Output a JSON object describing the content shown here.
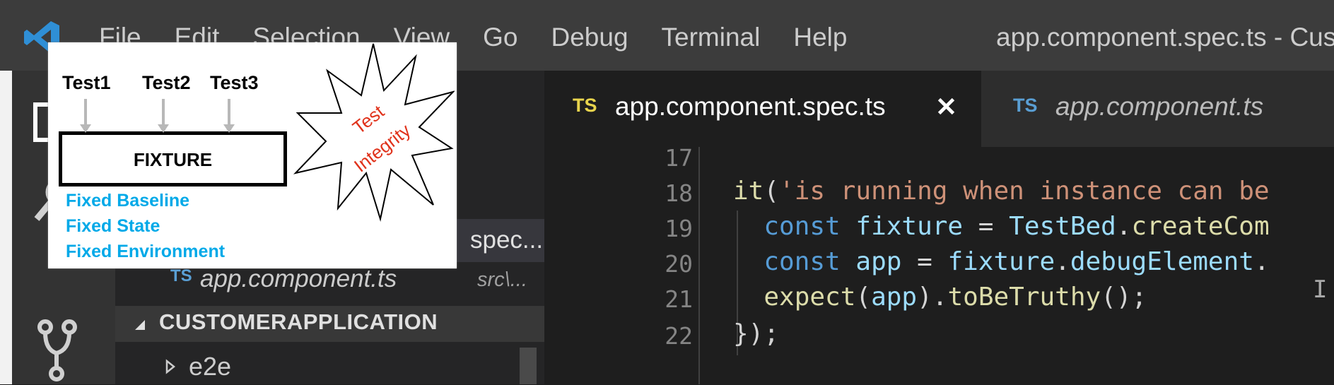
{
  "titlebar": {
    "menu": [
      "File",
      "Edit",
      "Selection",
      "View",
      "Go",
      "Debug",
      "Terminal",
      "Help"
    ],
    "window_title": "app.component.spec.ts - Cus"
  },
  "sidebar": {
    "open_editors": [
      {
        "name": "spec....",
        "selected": true
      },
      {
        "icon": "TS",
        "name": "app.component.ts",
        "path": "src\\..."
      }
    ],
    "section_title": "CUSTOMERAPPLICATION",
    "tree": [
      {
        "label": "e2e"
      }
    ]
  },
  "tabs": [
    {
      "badge": "TS",
      "label": "app.component.spec.ts",
      "close": "✕",
      "active": true
    },
    {
      "badge": "TS",
      "label": "app.component.ts",
      "active": false
    }
  ],
  "editor": {
    "line_numbers": [
      "17",
      "18",
      "19",
      "20",
      "21",
      "22"
    ],
    "lines": [
      {
        "tokens": []
      },
      {
        "tokens": [
          {
            "t": "it",
            "c": "fn"
          },
          {
            "t": "(",
            "c": "pl"
          },
          {
            "t": "'is running when instance can be",
            "c": "str"
          }
        ]
      },
      {
        "tokens": [
          {
            "t": "  const ",
            "c": "kw"
          },
          {
            "t": "fixture",
            "c": "var"
          },
          {
            "t": " = ",
            "c": "pl"
          },
          {
            "t": "TestBed",
            "c": "var"
          },
          {
            "t": ".",
            "c": "pl"
          },
          {
            "t": "createCom",
            "c": "fn"
          }
        ]
      },
      {
        "tokens": [
          {
            "t": "  const ",
            "c": "kw"
          },
          {
            "t": "app",
            "c": "var"
          },
          {
            "t": " = ",
            "c": "pl"
          },
          {
            "t": "fixture",
            "c": "var"
          },
          {
            "t": ".",
            "c": "pl"
          },
          {
            "t": "debugElement",
            "c": "var"
          },
          {
            "t": ".",
            "c": "pl"
          }
        ]
      },
      {
        "tokens": [
          {
            "t": "  expect",
            "c": "fn"
          },
          {
            "t": "(",
            "c": "pl"
          },
          {
            "t": "app",
            "c": "var"
          },
          {
            "t": ").",
            "c": "pl"
          },
          {
            "t": "toBeTruthy",
            "c": "fn"
          },
          {
            "t": "();",
            "c": "pl"
          }
        ]
      },
      {
        "tokens": [
          {
            "t": "});",
            "c": "pl"
          }
        ]
      }
    ],
    "cursor_glyph": "I"
  },
  "overlay": {
    "tests": [
      "Test1",
      "Test2",
      "Test3"
    ],
    "fixture_label": "FIXTURE",
    "fixed": [
      "Fixed Baseline",
      "Fixed State",
      "Fixed Environment"
    ],
    "burst_lines": [
      "Test",
      "Integrity"
    ]
  },
  "colors": {
    "ts_active": "#e8d44d",
    "ts_inactive": "#5a9fd4",
    "fixed_text": "#00a9e8",
    "burst_text": "#e0321b"
  }
}
